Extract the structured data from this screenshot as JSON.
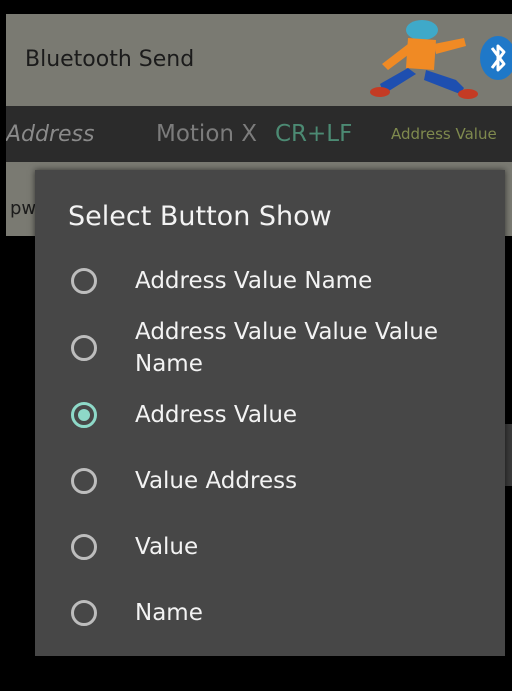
{
  "app": {
    "title": "Bluetooth Send"
  },
  "toolbar": {
    "address_label": "Address",
    "motion_label": "Motion X",
    "line_ending": "CR+LF",
    "display_mode": "Address Value"
  },
  "input": {
    "text": "pw"
  },
  "dialog": {
    "title": "Select Button Show",
    "options": [
      {
        "label": "Address Value Name",
        "checked": false
      },
      {
        "label": "Address Value Value Value Name",
        "checked": false
      },
      {
        "label": "Address Value",
        "checked": true
      },
      {
        "label": "Value Address",
        "checked": false
      },
      {
        "label": "Value",
        "checked": false
      },
      {
        "label": "Name",
        "checked": false
      }
    ]
  },
  "colors": {
    "accent": "#8ed9c8",
    "dialog_background": "#474747",
    "app_bar": "#7a7a72",
    "toolbar": "#2b2b2b",
    "line_ending_text": "#4c8a73",
    "display_mode_text": "#7f8a4e"
  },
  "icons": {
    "logo": "running-man-bluetooth-logo",
    "radio": "radio-button"
  }
}
